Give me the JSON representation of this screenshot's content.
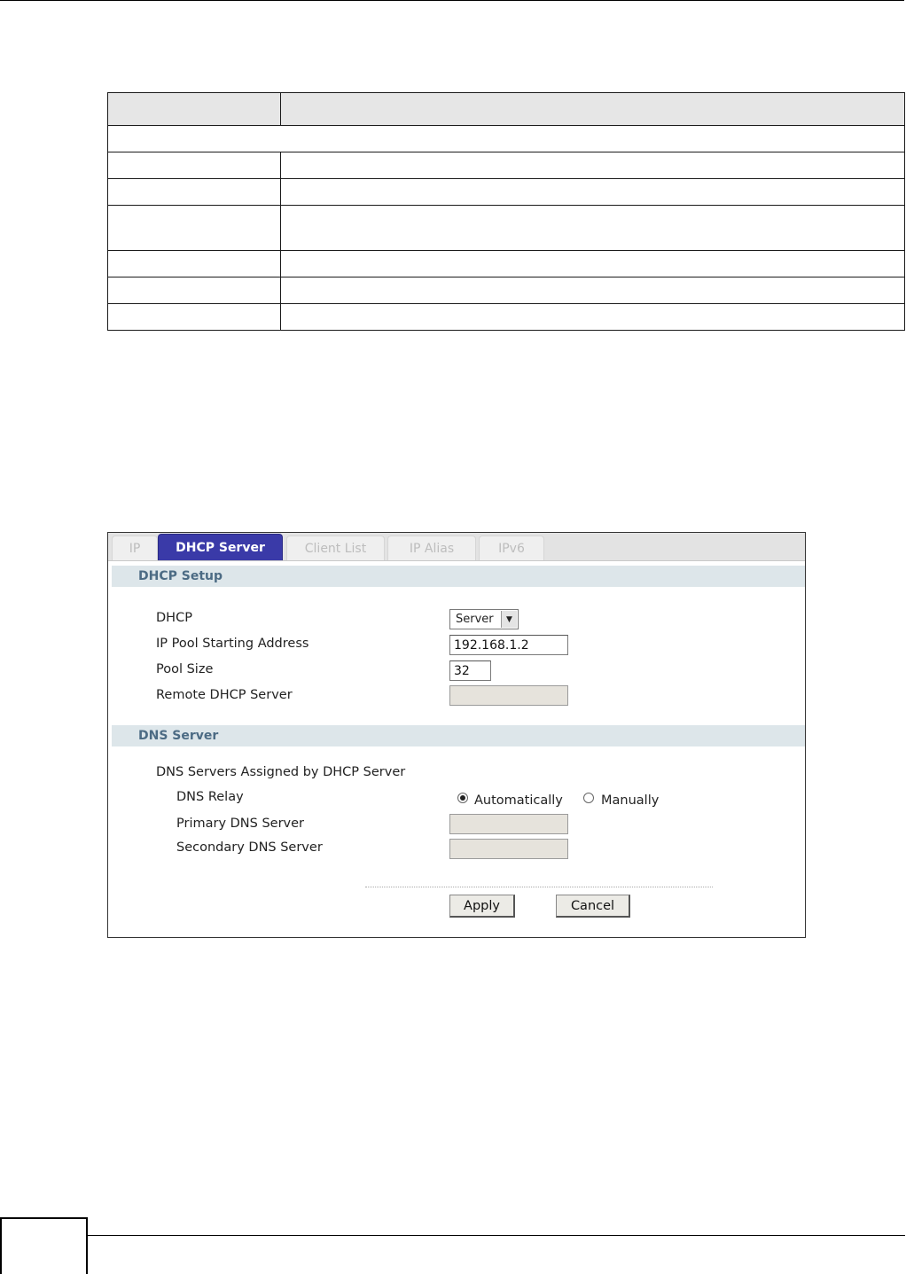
{
  "tabs": [
    {
      "label": "IP",
      "active": false
    },
    {
      "label": "DHCP Server",
      "active": true
    },
    {
      "label": "Client List",
      "active": false
    },
    {
      "label": "IP Alias",
      "active": false
    },
    {
      "label": "IPv6",
      "active": false
    }
  ],
  "dhcp_setup": {
    "heading": "DHCP Setup",
    "dhcp_label": "DHCP",
    "dhcp_value": "Server",
    "pool_start_label": "IP Pool Starting Address",
    "pool_start_value": "192.168.1.2",
    "pool_size_label": "Pool Size",
    "pool_size_value": "32",
    "remote_server_label": "Remote DHCP Server",
    "remote_server_value": ""
  },
  "dns_server": {
    "heading": "DNS Server",
    "assigned_label": "DNS Servers Assigned by DHCP Server",
    "relay_label": "DNS Relay",
    "option_auto": "Automatically",
    "option_manual": "Manually",
    "selected": "Automatically",
    "primary_label": "Primary DNS Server",
    "primary_value": "",
    "secondary_label": "Secondary DNS Server",
    "secondary_value": ""
  },
  "buttons": {
    "apply": "Apply",
    "cancel": "Cancel"
  },
  "colors": {
    "active_tab": "#3a3aa8",
    "section_header": "#dde6ea",
    "section_header_text": "#4c6b84"
  }
}
